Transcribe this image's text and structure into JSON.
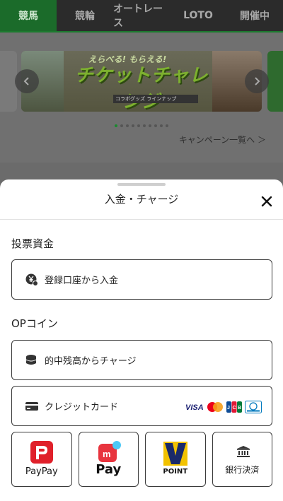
{
  "nav": {
    "tabs": [
      {
        "label": "競馬",
        "active": true
      },
      {
        "label": "競輪",
        "active": false
      },
      {
        "label": "オートレース",
        "active": false
      },
      {
        "label": "LOTO",
        "active": false
      },
      {
        "label": "開催中",
        "active": false
      }
    ]
  },
  "banner": {
    "headline": "チケットチャレンジ",
    "subline": "えらべる! もらえる!",
    "note": "コラボグッズ ラインナップ",
    "dots": 10,
    "active_dot": 0
  },
  "campaign_link": "キャンペーン一覧へ ＞",
  "sheet": {
    "title": "入金・チャージ",
    "sections": [
      {
        "label": "投票資金",
        "options": [
          {
            "label": "登録口座から入金",
            "icon": "yen-coin-icon"
          }
        ]
      },
      {
        "label": "OPコイン",
        "options": [
          {
            "label": "的中残高からチャージ",
            "icon": "coins-stack-icon"
          },
          {
            "label": "クレジットカード",
            "icon": "credit-card-icon"
          }
        ]
      }
    ],
    "card_brands": [
      "VISA",
      "Mastercard",
      "JCB",
      "Diners Club"
    ],
    "tiles": [
      {
        "label": "PayPay",
        "icon": "paypay-logo-icon"
      },
      {
        "label": "Pay",
        "icon": "merpay-logo-icon"
      },
      {
        "label": "POINT",
        "icon": "vpoint-logo-icon"
      },
      {
        "label": "銀行決済",
        "icon": "bank-icon"
      }
    ]
  },
  "colors": {
    "brand_green": "#1b7a2e",
    "paypay_red": "#e0202a",
    "merpay_red": "#e8343e",
    "vpoint_yellow": "#f2c200",
    "vpoint_navy": "#1a2a6a"
  }
}
